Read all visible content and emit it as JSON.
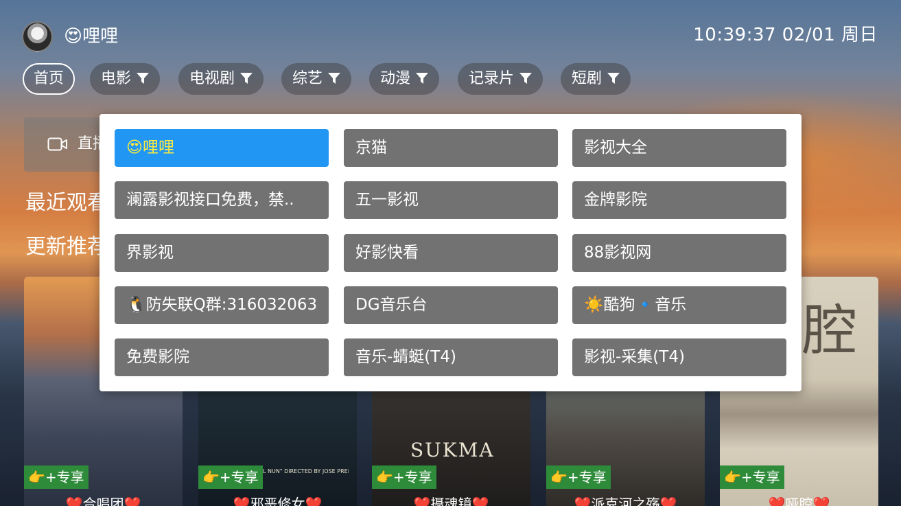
{
  "header": {
    "app_title": "😍哩哩",
    "clock": "10:39:37 02/01 周日"
  },
  "nav": {
    "tabs": [
      {
        "label": "首页",
        "active": true,
        "filter": false
      },
      {
        "label": "电影",
        "active": false,
        "filter": true
      },
      {
        "label": "电视剧",
        "active": false,
        "filter": true
      },
      {
        "label": "综艺",
        "active": false,
        "filter": true
      },
      {
        "label": "动漫",
        "active": false,
        "filter": true
      },
      {
        "label": "记录片",
        "active": false,
        "filter": true
      },
      {
        "label": "短剧",
        "active": false,
        "filter": true
      }
    ]
  },
  "home": {
    "live_label": "直播",
    "recent_title": "最近观看",
    "recommend_title": "更新推荐"
  },
  "dropdown": {
    "selected_index": 0,
    "sources": [
      "😍哩哩",
      "京猫",
      "影视大全",
      "澜露影视接口免费，禁..",
      "五一影视",
      "金牌影院",
      "界影视",
      "好影快看",
      "88影视网",
      "🐧防失联Q群:316032063",
      "DG音乐台",
      "☀️酷狗🔹音乐",
      "免费影院",
      "音乐-蜻蜓(T4)",
      "影视-采集(T4)"
    ]
  },
  "posters": [
    {
      "badge": "👉+专享",
      "title": "❤️合唱团❤️",
      "text": ""
    },
    {
      "badge": "👉+专享",
      "title": "❤️邪恶修女❤️",
      "text": "THE ASYLUM ... \"EVIL NUN\" DIRECTED BY JOSE PRENDES"
    },
    {
      "badge": "👉+专享",
      "title": "❤️摄魂镜❤️",
      "text": "SUKMA"
    },
    {
      "badge": "👉+专享",
      "title": "❤️派克河之殇❤️",
      "text": ""
    },
    {
      "badge": "👉+专享",
      "title": "❤️哑腔❤️",
      "text": "腔"
    }
  ],
  "colors": {
    "selected_bg": "#2196f3",
    "selected_text": "#ffeb3b",
    "item_bg": "#727272",
    "badge_bg": "#2e8b3a"
  }
}
